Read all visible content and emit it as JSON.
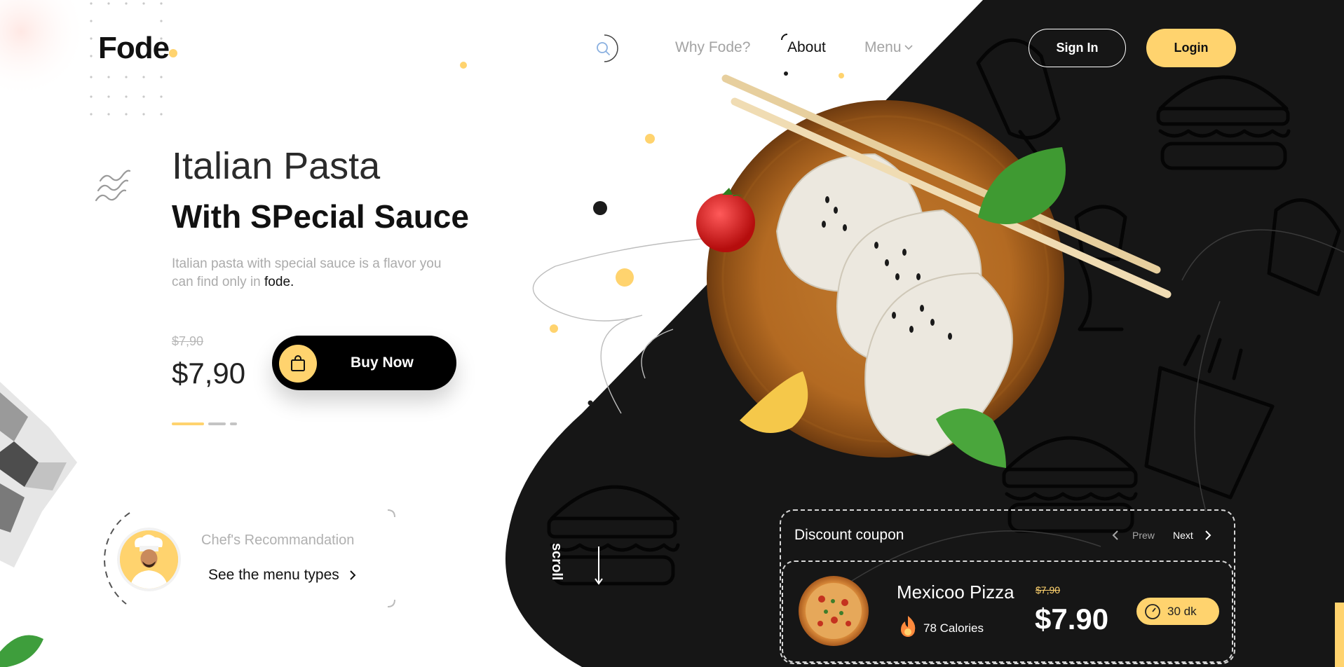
{
  "colors": {
    "accent": "#ffd36e",
    "dark": "#161616",
    "text": "#111111",
    "muted": "#ababab"
  },
  "nav": {
    "logo": "Fode",
    "links": [
      "Why Fode?",
      "About",
      "Menu"
    ],
    "active_link": "About",
    "sign_in": "Sign In",
    "login": "Login",
    "search_icon": "search-icon",
    "menu_chevron_icon": "chevron-down-icon"
  },
  "hero": {
    "title_line1": "Italian Pasta",
    "title_line2": "With SPecial Sauce",
    "description": "Italian pasta with special sauce is a flavor you can find only in ",
    "description_brand": "fode.",
    "old_price": "$7,90",
    "price": "$7,90",
    "buy_label": "Buy Now",
    "buy_icon": "shopping-bag-icon",
    "slider_pages": 3,
    "slider_active": 1
  },
  "chef": {
    "title": "Chef's Recommandation",
    "link": "See the menu types",
    "link_icon": "chevron-right-icon"
  },
  "scroll": {
    "label": "scroll",
    "icon": "arrow-down-icon"
  },
  "coupon": {
    "title": "Discount coupon",
    "prev": "Prew",
    "next": "Next",
    "item": {
      "name": "Mexicoo Pizza",
      "calories": "78 Calories",
      "old_price": "$7,90",
      "price": "$7.90",
      "time": "30 dk",
      "calorie_icon": "fire-icon",
      "time_icon": "clock-icon"
    }
  }
}
